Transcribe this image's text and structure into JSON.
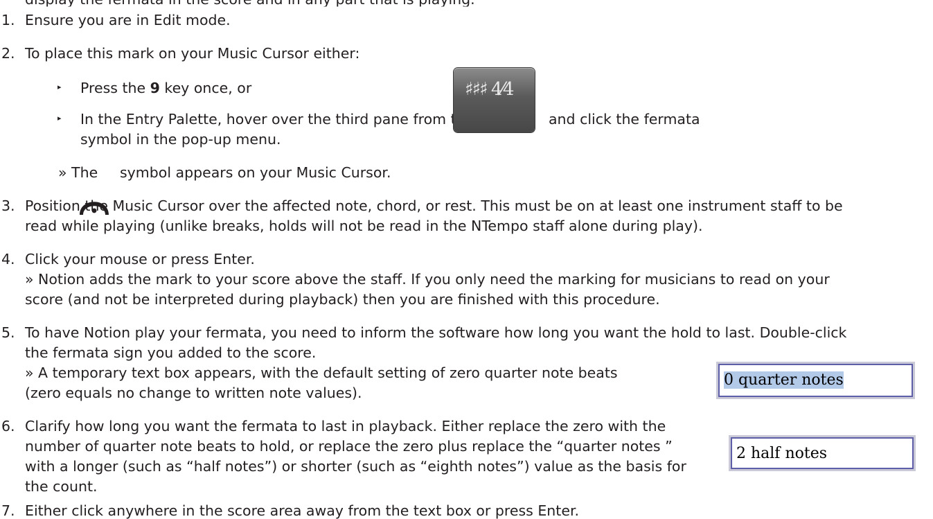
{
  "top_fragment": "display the fermata in the score and in any part that is playing.",
  "steps": [
    {
      "num": "1.",
      "text": "Ensure you are in Edit mode."
    },
    {
      "num": "2.",
      "text": "To place this mark on your Music Cursor either:"
    },
    {
      "num": "3.",
      "line1": "Position the Music Cursor over the affected note, chord, or rest. This must be on at least one instrument staff to be",
      "line2": "read while playing (unlike breaks, holds will not be read in the NTempo staff alone during play)."
    },
    {
      "num": "4.",
      "line1": "Click your mouse or press Enter.",
      "line2": "» Notion adds the mark to your score above the staff. If you only need the marking for musicians to read on your",
      "line3": "score (and not be interpreted during playback) then you are finished with this procedure."
    },
    {
      "num": "5.",
      "line1": "To have Notion play your fermata, you need to inform the software how long you want the hold to last. Double-click",
      "line2": "the fermata sign you added to the score.",
      "line3": "» A temporary text box appears, with the default setting of zero quarter note beats",
      "line4": "(zero equals no change to written note values)."
    },
    {
      "num": "6.",
      "line1": "Clarify how long you want the fermata to last in playback. Either replace the zero with the",
      "line2": "number of quarter note beats to hold, or replace the zero plus replace the “quarter notes ”",
      "line3": "with a longer (such as “half notes”) or shorter (such as “eighth notes”) value as the basis for",
      "line4": "the count."
    },
    {
      "num": "7.",
      "text": "Either click anywhere in the score area away from the text box or press Enter."
    }
  ],
  "sub": {
    "bullet1_pre": "Press the ",
    "bullet1_key": "9",
    "bullet1_post": " key once, or",
    "bullet2_line1_pre": "In the Entry Palette, hover over the third pane from the right",
    "bullet2_line1_post": "and click the fermata",
    "bullet2_line2": "symbol in the pop-up menu.",
    "result_pre": "» The",
    "result_post": "symbol appears on your Music Cursor."
  },
  "palette_glyph": "♯♯♯ 4⁄4",
  "textbox1": "0 quarter notes",
  "textbox2": "2 half notes",
  "icons": [
    "bullet-arrow-icon",
    "fermata-icon",
    "key-signature-palette-icon"
  ]
}
